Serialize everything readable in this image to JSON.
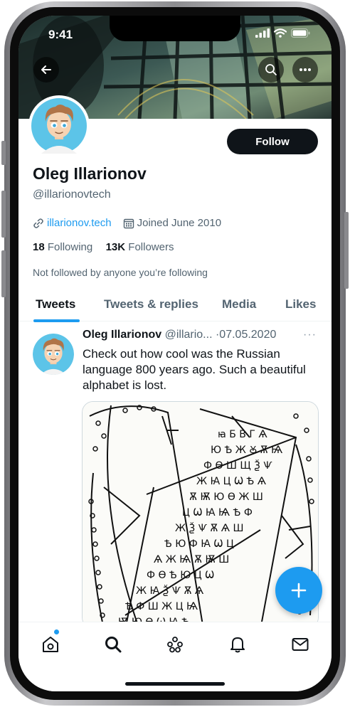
{
  "status_bar": {
    "time": "9:41"
  },
  "profile": {
    "name": "Oleg Illarionov",
    "handle": "@illarionovtech",
    "website": "illarionov.tech",
    "joined": "Joined June 2010",
    "following_count": "18",
    "following_label": "Following",
    "followers_count": "13K",
    "followers_label": "Followers",
    "not_followed_text": "Not followed by anyone you’re following",
    "follow_button": "Follow"
  },
  "tabs": [
    {
      "label": "Tweets",
      "active": true
    },
    {
      "label": "Tweets & replies",
      "active": false
    },
    {
      "label": "Media",
      "active": false
    },
    {
      "label": "Likes",
      "active": false
    }
  ],
  "tweet": {
    "author_name": "Oleg Illarionov",
    "author_handle": "@illario...",
    "separator": "·",
    "date": "07.05.2020",
    "more": "···",
    "text": "Check out how cool was the Russian language 800 years ago.  Such a beautiful alphabet is lost.",
    "media_description": "birch bark manuscript drawing"
  },
  "icons": {
    "back": "arrow-left-icon",
    "search": "search-icon",
    "more": "more-dots-icon",
    "link": "link-icon",
    "calendar": "calendar-icon",
    "compose": "plus-icon",
    "nav": [
      "home-icon",
      "search-icon",
      "spaces-icon",
      "bell-icon",
      "mail-icon"
    ]
  },
  "colors": {
    "accent": "#1d9bf0",
    "text_primary": "#0f1419",
    "text_secondary": "#536471",
    "follow_button_bg": "#0f1419"
  }
}
